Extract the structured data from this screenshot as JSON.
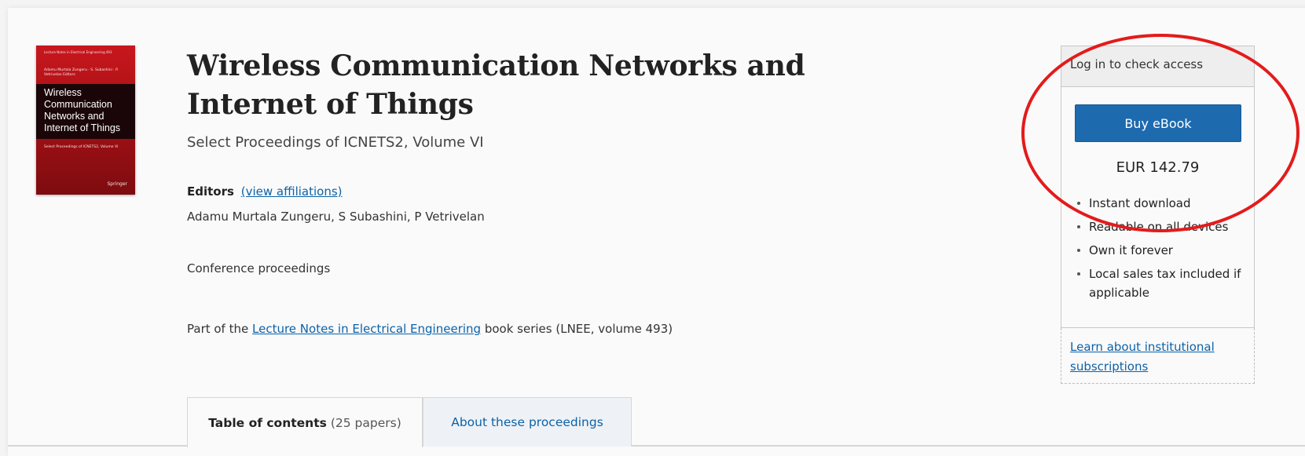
{
  "book": {
    "title": "Wireless Communication Networks and Internet of Things",
    "subtitle": "Select Proceedings of ICNETS2, Volume VI",
    "editors_label": "Editors",
    "view_affiliations": "(view affiliations)",
    "editors": "Adamu Murtala Zungeru, S Subashini, P Vetrivelan",
    "content_type": "Conference proceedings",
    "series_prefix": "Part of the",
    "series_link": "Lecture Notes in Electrical Engineering",
    "series_suffix": "book series (LNEE, volume 493)"
  },
  "cover": {
    "series": "Lecture Notes in Electrical Engineering 493",
    "authors": "Adamu Murtala Zungeru · S. Subashini · P. Vetrivelan Editors",
    "title": "Wireless Communication Networks and Internet of Things",
    "subtitle": "Select Proceedings of ICNETS2, Volume VI",
    "publisher": "Springer",
    "color": "#c8171d"
  },
  "tabs": {
    "toc_label": "Table of contents",
    "toc_count": "(25 papers)",
    "about_label": "About these proceedings"
  },
  "purchase": {
    "login_text": "Log in to check access",
    "buy_label": "Buy eBook",
    "price": "EUR 142.79",
    "benefits": [
      "Instant download",
      "Readable on all devices",
      "Own it forever",
      "Local sales tax included if applicable"
    ],
    "institutional_link": "Learn about institutional subscriptions",
    "button_color": "#1d6aae"
  },
  "annotation": {
    "color": "#e41b1b",
    "shape": "ellipse"
  }
}
